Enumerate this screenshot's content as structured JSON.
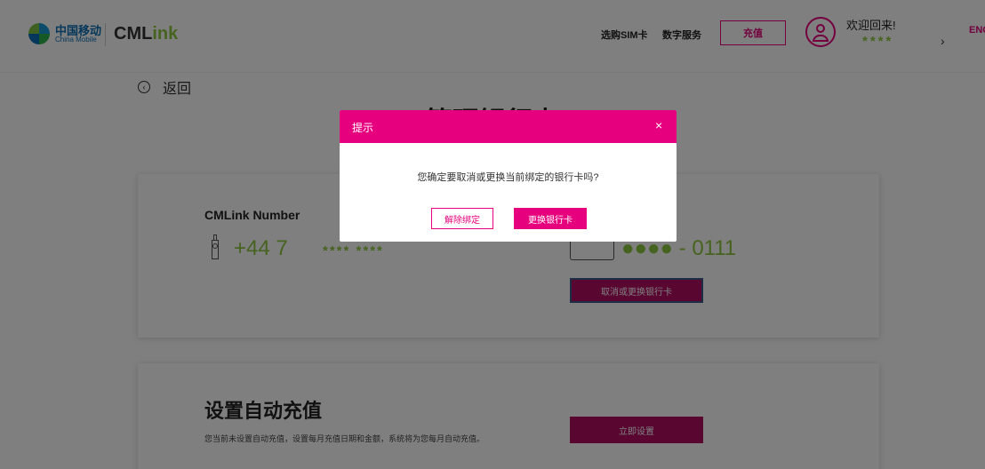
{
  "header": {
    "logo_cm_zh": "中国移动",
    "logo_cm_en": "China Mobile",
    "logo_cml_a": "CML",
    "logo_cml_b": "ink",
    "nav": [
      "选购SIM卡",
      "数字服务"
    ],
    "recharge_label": "充值",
    "welcome": "欢迎回来!",
    "user_masked": "****",
    "chevron": "›",
    "lang": "ENG"
  },
  "page": {
    "back_icon": "‹",
    "back_label": "返回",
    "title": "管理银行卡"
  },
  "card_binding": {
    "number_label": "CMLink Number",
    "phone_prefix": "+44 7",
    "phone_masked": "****  ****",
    "bank_number": "●●●● - 0111",
    "change_button": "取消或更换银行卡"
  },
  "auto_topup": {
    "title": "设置自动充值",
    "description": "您当前未设置自动充值，设置每月充值日期和金额，系统将为您每月自动充值。",
    "setup_button": "立即设置"
  },
  "dialog": {
    "title": "提示",
    "close_icon": "×",
    "message": "您确定要取消或更换当前绑定的银行卡吗?",
    "unbind_label": "解除绑定",
    "change_label": "更换银行卡"
  },
  "colors": {
    "brand_magenta": "#e6007e",
    "brand_green": "#8cc63f",
    "button_dark": "#b30d63"
  }
}
